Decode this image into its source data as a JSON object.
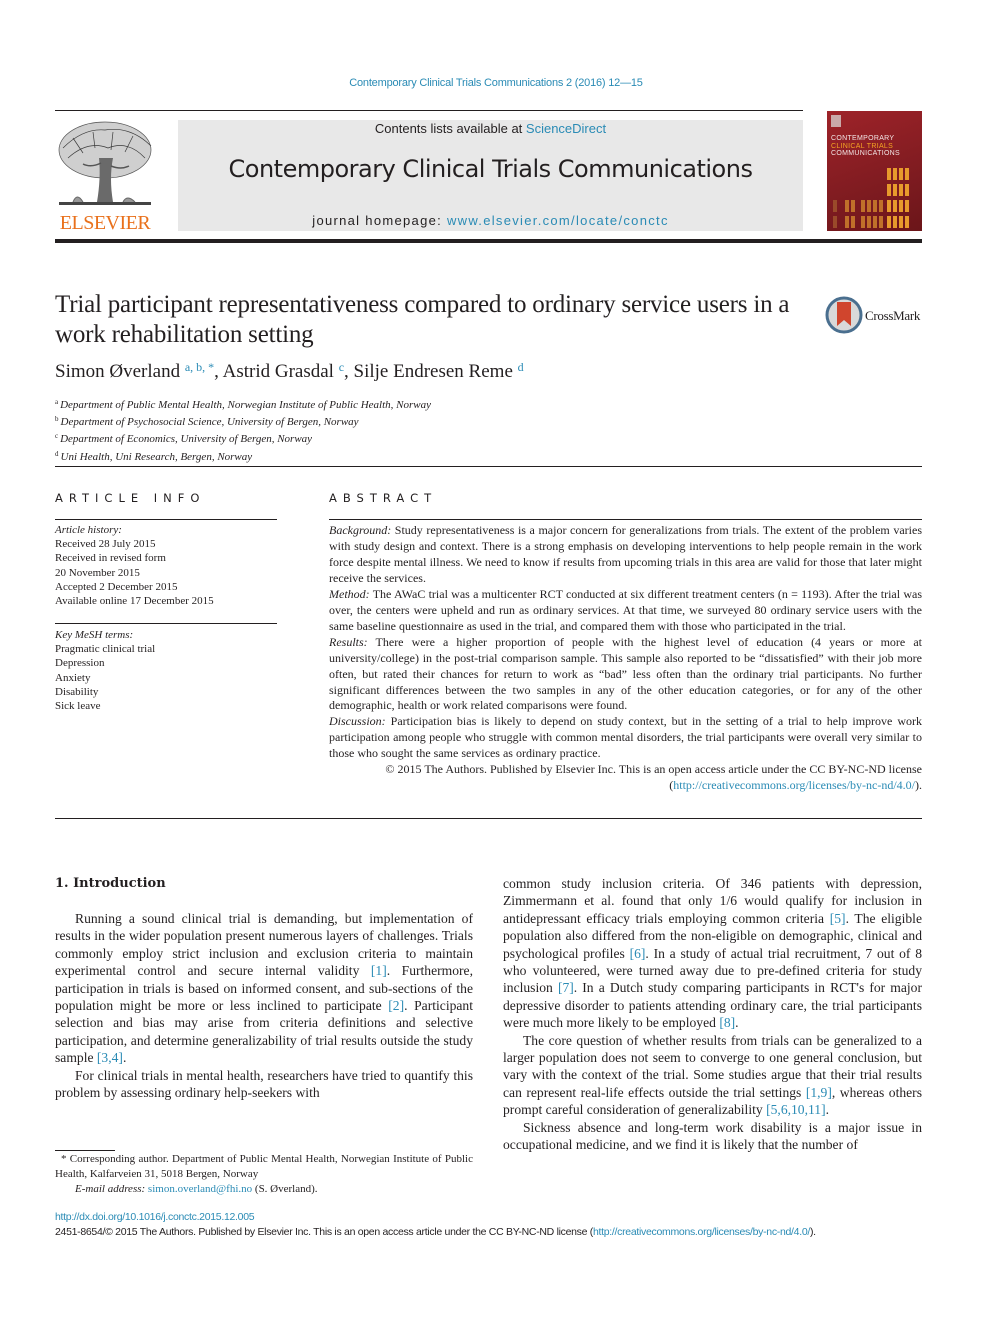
{
  "running_head": "Contemporary Clinical Trials Communications 2 (2016) 12—15",
  "masthead": {
    "publisher_word": "ELSEVIER",
    "contents_prefix": "Contents lists available at ",
    "contents_link": "ScienceDirect",
    "journal_title": "Contemporary Clinical Trials Communications",
    "homepage_prefix": "journal homepage: ",
    "homepage_link": "www.elsevier.com/locate/conctc",
    "cover_line1": "CONTEMPORARY",
    "cover_line2": "CLINICAL TRIALS",
    "cover_line3": "COMMUNICATIONS"
  },
  "crossmark_label": "CrossMark",
  "article": {
    "title": "Trial participant representativeness compared to ordinary service users in a work rehabilitation setting",
    "authors": [
      {
        "name": "Simon Øverland",
        "sup": "a, b, *"
      },
      {
        "name": "Astrid Grasdal",
        "sup": "c"
      },
      {
        "name": "Silje Endresen Reme",
        "sup": "d"
      }
    ],
    "affiliations": [
      {
        "key": "a",
        "text": "Department of Public Mental Health, Norwegian Institute of Public Health, Norway"
      },
      {
        "key": "b",
        "text": "Department of Psychosocial Science, University of Bergen, Norway"
      },
      {
        "key": "c",
        "text": "Department of Economics, University of Bergen, Norway"
      },
      {
        "key": "d",
        "text": "Uni Health, Uni Research, Bergen, Norway"
      }
    ]
  },
  "article_info": {
    "heading": "ARTICLE INFO",
    "history_label": "Article history:",
    "history": [
      "Received 28 July 2015",
      "Received in revised form",
      "20 November 2015",
      "Accepted 2 December 2015",
      "Available online 17 December 2015"
    ],
    "keywords_label": "Key MeSH terms:",
    "keywords": [
      "Pragmatic clinical trial",
      "Depression",
      "Anxiety",
      "Disability",
      "Sick leave"
    ]
  },
  "abstract": {
    "heading": "ABSTRACT",
    "sections": [
      {
        "label": "Background:",
        "text": " Study representativeness is a major concern for generalizations from trials. The extent of the problem varies with study design and context. There is a strong emphasis on developing interventions to help people remain in the work force despite mental illness. We need to know if results from upcoming trials in this area are valid for those that later might receive the services."
      },
      {
        "label": "Method:",
        "text": " The AWaC trial was a multicenter RCT conducted at six different treatment centers (n = 1193). After the trial was over, the centers were upheld and run as ordinary services. At that time, we surveyed 80 ordinary service users with the same baseline questionnaire as used in the trial, and compared them with those who participated in the trial."
      },
      {
        "label": "Results:",
        "text": " There were a higher proportion of people with the highest level of education (4 years or more at university/college) in the post-trial comparison sample. This sample also reported to be “dissatisfied” with their job more often, but rated their chances for return to work as “bad” less often than the ordinary trial participants. No further significant differences between the two samples in any of the other education categories, or for any of the other demographic, health or work related comparisons were found."
      },
      {
        "label": "Discussion:",
        "text": " Participation bias is likely to depend on study context, but in the setting of a trial to help improve work participation among people who struggle with common mental disorders, the trial participants were overall very similar to those who sought the same services as ordinary practice."
      }
    ],
    "copyright_text": "© 2015 The Authors. Published by Elsevier Inc. This is an open access article under the CC BY-NC-ND license (",
    "copyright_link": "http://creativecommons.org/licenses/by-nc-nd/4.0/",
    "copyright_end": ")."
  },
  "intro": {
    "heading": "1.  Introduction",
    "left_paragraphs": [
      [
        {
          "t": "Running a sound clinical trial is demanding, but implementation of results in the wider population present numerous layers of challenges. Trials commonly employ strict inclusion and exclusion criteria to maintain experimental control and secure internal validity "
        },
        {
          "ref": "[1]"
        },
        {
          "t": ". Furthermore, participation in trials is based on informed consent, and sub-sections of the population might be more or less inclined to participate "
        },
        {
          "ref": "[2]"
        },
        {
          "t": ". Participant selection and bias may arise from criteria definitions and selective participation, and determine generalizability of trial results outside the study sample "
        },
        {
          "ref": "[3,4]"
        },
        {
          "t": "."
        }
      ],
      [
        {
          "t": "For clinical trials in mental health, researchers have tried to quantify this problem by assessing ordinary help-seekers with"
        }
      ]
    ],
    "right_paragraphs": [
      [
        {
          "t": "common study inclusion criteria. Of 346 patients with depression, Zimmermann et al. found that only 1/6 would qualify for inclusion in antidepressant efficacy trials employing common criteria "
        },
        {
          "ref": "[5]"
        },
        {
          "t": ". The eligible population also differed from the non-eligible on demographic, clinical and psychological profiles "
        },
        {
          "ref": "[6]"
        },
        {
          "t": ". In a study of actual trial recruitment, 7 out of 8 who volunteered, were turned away due to pre-defined criteria for study inclusion "
        },
        {
          "ref": "[7]"
        },
        {
          "t": ". In a Dutch study comparing participants in RCT's for major depressive disorder to patients attending ordinary care, the trial participants were much more likely to be employed "
        },
        {
          "ref": "[8]"
        },
        {
          "t": "."
        }
      ],
      [
        {
          "t": "The core question of whether results from trials can be generalized to a larger population does not seem to converge to one general conclusion, but vary with the context of the trial. Some studies argue that their trial results can represent real-life effects outside the trial settings "
        },
        {
          "ref": "[1,9]"
        },
        {
          "t": ", whereas others prompt careful consideration of generalizability "
        },
        {
          "ref": "[5,6,10,11]"
        },
        {
          "t": "."
        }
      ],
      [
        {
          "t": "Sickness absence and long-term work disability is a major issue in occupational medicine, and we find it is likely that the number of"
        }
      ]
    ]
  },
  "footnote": {
    "corresponding": "* Corresponding author. Department of Public Mental Health, Norwegian Institute of Public Health, Kalfarveien 31, 5018 Bergen, Norway",
    "email_label": "E-mail address:",
    "email": "simon.overland@fhi.no",
    "email_suffix": " (S. Øverland)."
  },
  "bottom": {
    "doi": "http://dx.doi.org/10.1016/j.conctc.2015.12.005",
    "issn_text": "2451-8654/© 2015 The Authors. Published by Elsevier Inc. This is an open access article under the CC BY-NC-ND license (",
    "issn_link": "http://creativecommons.org/licenses/by-nc-nd/4.0/",
    "issn_end": ")."
  }
}
